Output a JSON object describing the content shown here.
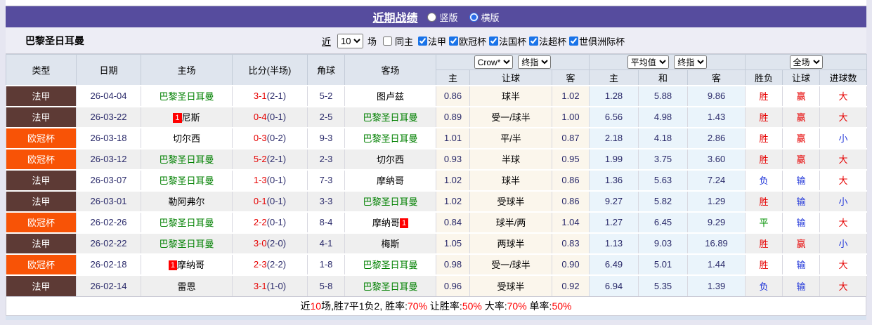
{
  "colors": {
    "title_bar_bg": "#564c9e",
    "ligue1_badge": "#5d3a35",
    "ucl_badge": "#f85306",
    "followed_team_green": "#008000",
    "score_red": "#e60000",
    "win_red": "#e60000",
    "loss_blue": "#2136d9",
    "draw_green": "#009000",
    "handicap_col_bg": "#fbf6ec",
    "avg_col_bg": "#eaf4fb"
  },
  "header": {
    "title": "近期战绩",
    "radio_vertical": "竖版",
    "radio_horizontal": "横版",
    "horizontal_selected": true
  },
  "filters": {
    "team_title": "巴黎圣日耳曼",
    "recent_label": "近",
    "recent_value": "10",
    "matches_label": "场",
    "same_home_label": "同主",
    "same_home_checked": false,
    "leagues": [
      {
        "label": "法甲",
        "checked": true
      },
      {
        "label": "欧冠杯",
        "checked": true
      },
      {
        "label": "法国杯",
        "checked": true
      },
      {
        "label": "法超杯",
        "checked": true
      },
      {
        "label": "世俱洲际杯",
        "checked": true
      }
    ]
  },
  "table": {
    "left_columns": [
      "类型",
      "日期",
      "主场",
      "比分(半场)",
      "角球",
      "客场"
    ],
    "sub_columns": [
      "主",
      "让球",
      "客",
      "主",
      "和",
      "客",
      "胜负",
      "让球",
      "进球数"
    ],
    "dropdowns": {
      "bookmaker": "Crow*",
      "bookmaker_final": "终指",
      "average": "平均值",
      "average_final": "终指",
      "scope": "全场"
    },
    "rows": [
      {
        "league": "法甲",
        "league_color": "#5d3a35",
        "date": "26-04-04",
        "home": {
          "name": "巴黎圣日耳曼",
          "green": true
        },
        "score_full": "3-1",
        "score_half": "(2-1)",
        "corners": "5-2",
        "away": {
          "name": "图卢兹",
          "green": false
        },
        "handicap_odds": [
          "0.86",
          "球半",
          "1.02"
        ],
        "avg_odds": [
          "1.28",
          "5.88",
          "9.86"
        ],
        "results": [
          {
            "text": "胜",
            "color": "red"
          },
          {
            "text": "赢",
            "color": "red"
          },
          {
            "text": "大",
            "color": "red"
          }
        ]
      },
      {
        "league": "法甲",
        "league_color": "#5d3a35",
        "date": "26-03-22",
        "home": {
          "name": "尼斯",
          "green": false,
          "badge_before": "1"
        },
        "score_full": "0-4",
        "score_half": "(0-1)",
        "corners": "2-5",
        "away": {
          "name": "巴黎圣日耳曼",
          "green": true
        },
        "handicap_odds": [
          "0.89",
          "受一/球半",
          "1.00"
        ],
        "avg_odds": [
          "6.56",
          "4.98",
          "1.43"
        ],
        "results": [
          {
            "text": "胜",
            "color": "red"
          },
          {
            "text": "赢",
            "color": "red"
          },
          {
            "text": "大",
            "color": "red"
          }
        ]
      },
      {
        "league": "欧冠杯",
        "league_color": "#f85306",
        "date": "26-03-18",
        "home": {
          "name": "切尔西",
          "green": false
        },
        "score_full": "0-3",
        "score_half": "(0-2)",
        "corners": "9-3",
        "away": {
          "name": "巴黎圣日耳曼",
          "green": true
        },
        "handicap_odds": [
          "1.01",
          "平/半",
          "0.87"
        ],
        "avg_odds": [
          "2.18",
          "4.18",
          "2.86"
        ],
        "results": [
          {
            "text": "胜",
            "color": "red"
          },
          {
            "text": "赢",
            "color": "red"
          },
          {
            "text": "小",
            "color": "blue"
          }
        ]
      },
      {
        "league": "欧冠杯",
        "league_color": "#f85306",
        "date": "26-03-12",
        "home": {
          "name": "巴黎圣日耳曼",
          "green": true
        },
        "score_full": "5-2",
        "score_half": "(2-1)",
        "corners": "2-3",
        "away": {
          "name": "切尔西",
          "green": false
        },
        "handicap_odds": [
          "0.93",
          "半球",
          "0.95"
        ],
        "avg_odds": [
          "1.99",
          "3.75",
          "3.60"
        ],
        "results": [
          {
            "text": "胜",
            "color": "red"
          },
          {
            "text": "赢",
            "color": "red"
          },
          {
            "text": "大",
            "color": "red"
          }
        ]
      },
      {
        "league": "法甲",
        "league_color": "#5d3a35",
        "date": "26-03-07",
        "home": {
          "name": "巴黎圣日耳曼",
          "green": true
        },
        "score_full": "1-3",
        "score_half": "(0-1)",
        "corners": "7-3",
        "away": {
          "name": "摩纳哥",
          "green": false
        },
        "handicap_odds": [
          "1.02",
          "球半",
          "0.86"
        ],
        "avg_odds": [
          "1.36",
          "5.63",
          "7.24"
        ],
        "results": [
          {
            "text": "负",
            "color": "blue"
          },
          {
            "text": "输",
            "color": "blue"
          },
          {
            "text": "大",
            "color": "red"
          }
        ]
      },
      {
        "league": "法甲",
        "league_color": "#5d3a35",
        "date": "26-03-01",
        "home": {
          "name": "勒阿弗尔",
          "green": false
        },
        "score_full": "0-1",
        "score_half": "(0-1)",
        "corners": "3-3",
        "away": {
          "name": "巴黎圣日耳曼",
          "green": true
        },
        "handicap_odds": [
          "1.02",
          "受球半",
          "0.86"
        ],
        "avg_odds": [
          "9.27",
          "5.82",
          "1.29"
        ],
        "results": [
          {
            "text": "胜",
            "color": "red"
          },
          {
            "text": "输",
            "color": "blue"
          },
          {
            "text": "小",
            "color": "blue"
          }
        ]
      },
      {
        "league": "欧冠杯",
        "league_color": "#f85306",
        "date": "26-02-26",
        "home": {
          "name": "巴黎圣日耳曼",
          "green": true
        },
        "score_full": "2-2",
        "score_half": "(0-1)",
        "corners": "8-4",
        "away": {
          "name": "摩纳哥",
          "green": false,
          "badge_after": "1"
        },
        "handicap_odds": [
          "0.84",
          "球半/两",
          "1.04"
        ],
        "avg_odds": [
          "1.27",
          "6.45",
          "9.29"
        ],
        "results": [
          {
            "text": "平",
            "color": "green"
          },
          {
            "text": "输",
            "color": "blue"
          },
          {
            "text": "大",
            "color": "red"
          }
        ]
      },
      {
        "league": "法甲",
        "league_color": "#5d3a35",
        "date": "26-02-22",
        "home": {
          "name": "巴黎圣日耳曼",
          "green": true
        },
        "score_full": "3-0",
        "score_half": "(2-0)",
        "corners": "4-1",
        "away": {
          "name": "梅斯",
          "green": false
        },
        "handicap_odds": [
          "1.05",
          "两球半",
          "0.83"
        ],
        "avg_odds": [
          "1.13",
          "9.03",
          "16.89"
        ],
        "results": [
          {
            "text": "胜",
            "color": "red"
          },
          {
            "text": "赢",
            "color": "red"
          },
          {
            "text": "小",
            "color": "blue"
          }
        ]
      },
      {
        "league": "欧冠杯",
        "league_color": "#f85306",
        "date": "26-02-18",
        "home": {
          "name": "摩纳哥",
          "green": false,
          "badge_before": "1"
        },
        "score_full": "2-3",
        "score_half": "(2-2)",
        "corners": "1-8",
        "away": {
          "name": "巴黎圣日耳曼",
          "green": true
        },
        "handicap_odds": [
          "0.98",
          "受一/球半",
          "0.90"
        ],
        "avg_odds": [
          "6.49",
          "5.01",
          "1.44"
        ],
        "results": [
          {
            "text": "胜",
            "color": "red"
          },
          {
            "text": "输",
            "color": "blue"
          },
          {
            "text": "大",
            "color": "red"
          }
        ]
      },
      {
        "league": "法甲",
        "league_color": "#5d3a35",
        "date": "26-02-14",
        "home": {
          "name": "雷恩",
          "green": false
        },
        "score_full": "3-1",
        "score_half": "(1-0)",
        "corners": "5-8",
        "away": {
          "name": "巴黎圣日耳曼",
          "green": true
        },
        "handicap_odds": [
          "0.96",
          "受球半",
          "0.92"
        ],
        "avg_odds": [
          "6.94",
          "5.35",
          "1.39"
        ],
        "results": [
          {
            "text": "负",
            "color": "blue"
          },
          {
            "text": "输",
            "color": "blue"
          },
          {
            "text": "大",
            "color": "red"
          }
        ]
      }
    ]
  },
  "footer": {
    "segments": [
      {
        "text": "近",
        "red": false
      },
      {
        "text": "10",
        "red": true
      },
      {
        "text": "场,胜7平1负2, 胜率:",
        "red": false
      },
      {
        "text": "70%",
        "red": true
      },
      {
        "text": " 让胜率:",
        "red": false
      },
      {
        "text": "50%",
        "red": true
      },
      {
        "text": " 大率:",
        "red": false
      },
      {
        "text": "70%",
        "red": true
      },
      {
        "text": " 单率:",
        "red": false
      },
      {
        "text": "50%",
        "red": true
      }
    ]
  }
}
